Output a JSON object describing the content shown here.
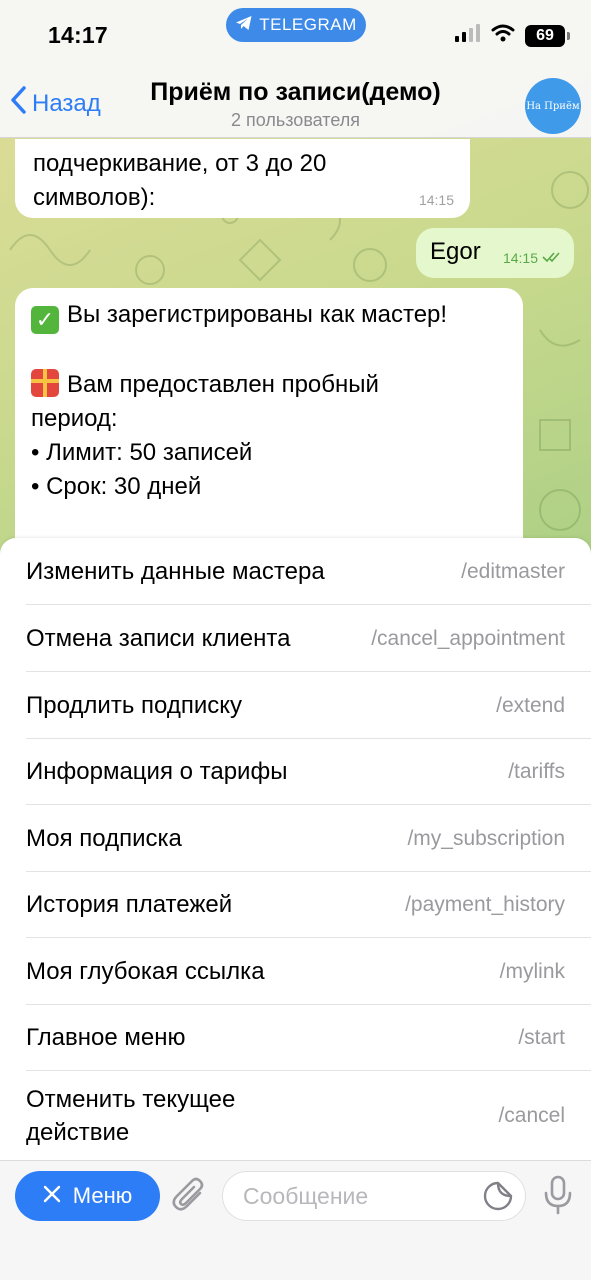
{
  "status_bar": {
    "time": "14:17",
    "app_pill": "TELEGRAM",
    "battery": "69"
  },
  "nav": {
    "back_label": "Назад",
    "title": "Приём по записи(демо)",
    "subtitle": "2 пользователя",
    "avatar_text": "На Приём"
  },
  "messages": {
    "m1": {
      "lines": [
        "подчеркивание, от 3 до 20",
        "символов):"
      ],
      "time": "14:15"
    },
    "m2": {
      "text": "Egor",
      "time": "14:15"
    },
    "m3": {
      "line1": "Вы зарегистрированы как мастер!",
      "line2": "Вам предоставлен пробный",
      "line3": "период:",
      "line4": "• Лимит: 50 записей",
      "line5": "• Срок: 30 дней"
    }
  },
  "commands": [
    {
      "label": "Изменить данные мастера",
      "command": "/editmaster"
    },
    {
      "label": "Отмена записи клиента",
      "command": "/cancel_appointment"
    },
    {
      "label": "Продлить подписку",
      "command": "/extend"
    },
    {
      "label": "Информация о тарифы",
      "command": "/tariffs"
    },
    {
      "label": "Моя подписка",
      "command": "/my_subscription"
    },
    {
      "label": "История платежей",
      "command": "/payment_history"
    },
    {
      "label": "Моя глубокая ссылка",
      "command": "/mylink"
    },
    {
      "label": "Главное меню",
      "command": "/start"
    },
    {
      "label": "Отменить текущее действие",
      "command": "/cancel"
    }
  ],
  "input_bar": {
    "menu_label": "Меню",
    "placeholder": "Сообщение"
  },
  "colors": {
    "accent": "#2d7df6",
    "outgoing_bubble": "#e5f8cd",
    "read_check": "#59a94a"
  },
  "icons": [
    "telegram-plane-icon",
    "signal-icon",
    "wifi-icon",
    "battery-icon",
    "back-chevron-icon",
    "check-emoji-icon",
    "gift-emoji-icon",
    "double-check-icon",
    "close-x-icon",
    "paperclip-icon",
    "sticker-icon",
    "microphone-icon"
  ]
}
